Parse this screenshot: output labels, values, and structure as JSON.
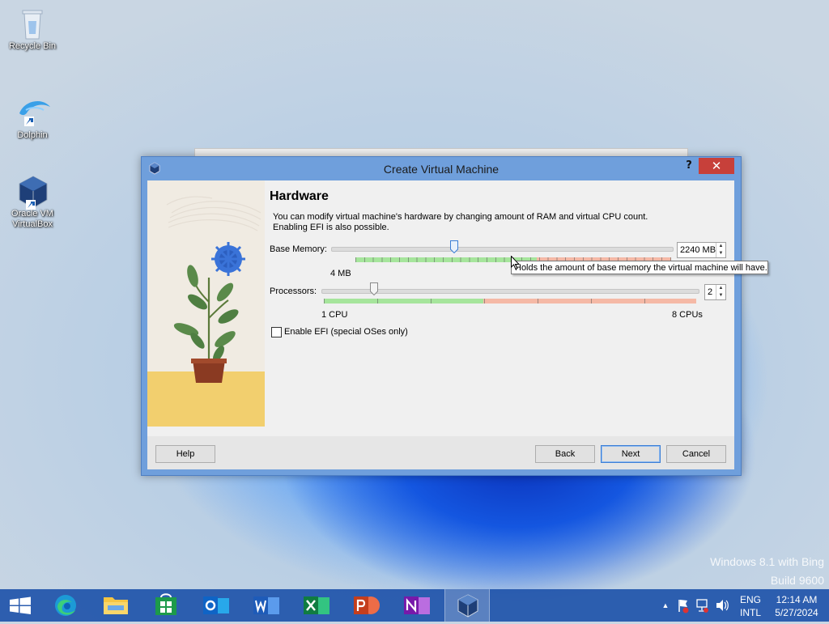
{
  "desktop": {
    "icons": [
      {
        "label": "Recycle Bin"
      },
      {
        "label": "Dolphin"
      },
      {
        "label": "Oracle VM VirtualBox"
      }
    ],
    "watermark": {
      "line1": "Windows 8.1 with Bing",
      "line2": "Build 9600"
    }
  },
  "dialog": {
    "title": "Create Virtual Machine",
    "help_symbol": "?",
    "close_symbol": "✕",
    "heading": "Hardware",
    "description_line1": "You can modify virtual machine's hardware by changing amount of RAM and virtual CPU count.",
    "description_line2": "Enabling EFI is also possible.",
    "memory": {
      "label": "Base Memory:",
      "value": "2240 MB",
      "min_label": "4 MB",
      "max_label": "",
      "fraction": 0.36
    },
    "processors": {
      "label": "Processors:",
      "value": "2",
      "min_label": "1 CPU",
      "max_label": "8 CPUs",
      "fraction": 0.14
    },
    "efi_checkbox": {
      "label": "Enable EFI (special OSes only)",
      "checked": false
    },
    "tooltip": "Holds the amount of base memory the virtual machine will have.",
    "buttons": {
      "help": "Help",
      "back": "Back",
      "next": "Next",
      "cancel": "Cancel"
    }
  },
  "taskbar": {
    "apps": [
      "edge",
      "file-explorer",
      "store",
      "outlook",
      "word",
      "excel",
      "powerpoint",
      "onenote",
      "virtualbox"
    ],
    "tray": {
      "language_top": "ENG",
      "language_bottom": "INTL",
      "time": "12:14 AM",
      "date": "5/27/2024",
      "overflow_symbol": "▲"
    }
  },
  "colors": {
    "accent": "#3c7fd6",
    "title_bar": "#6f9fdc",
    "close": "#c7403a",
    "taskbar": "#2054aa"
  }
}
